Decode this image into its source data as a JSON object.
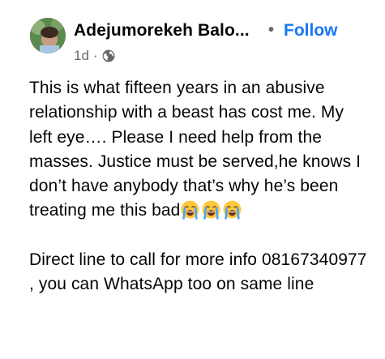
{
  "post": {
    "author_name": "Adejumorekeh Balo...",
    "separator": "•",
    "follow_label": "Follow",
    "time_ago": "1d",
    "meta_separator": "·",
    "privacy_icon": "globe-icon",
    "paragraph1": "This is what fifteen years in an abusive relationship with a beast has cost me. My left eye…. Please I need help from the masses. Justice must be served,he knows I don’t have anybody that’s why he’s been treating me this bad",
    "emojis": [
      "loudly-crying-face",
      "loudly-crying-face",
      "loudly-crying-face"
    ],
    "paragraph2": "Direct line to call for more info 08167340977 , you can WhatsApp too on same line"
  },
  "colors": {
    "text": "#050505",
    "secondary": "#65676b",
    "accent": "#1877f2",
    "background": "#ffffff"
  }
}
